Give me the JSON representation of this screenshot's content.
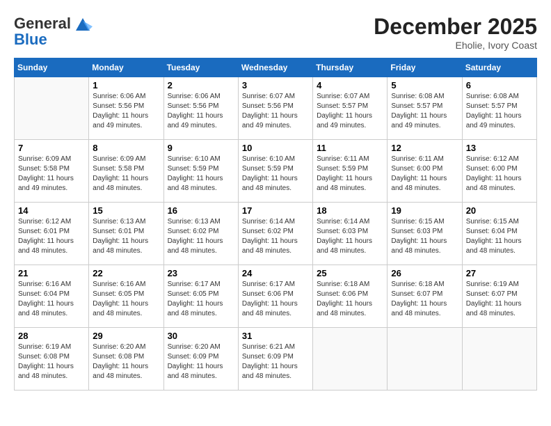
{
  "header": {
    "logo_line1": "General",
    "logo_line2": "Blue",
    "month": "December 2025",
    "location": "Eholie, Ivory Coast"
  },
  "weekdays": [
    "Sunday",
    "Monday",
    "Tuesday",
    "Wednesday",
    "Thursday",
    "Friday",
    "Saturday"
  ],
  "weeks": [
    [
      {
        "day": "",
        "sunrise": "",
        "sunset": "",
        "daylight": ""
      },
      {
        "day": "1",
        "sunrise": "Sunrise: 6:06 AM",
        "sunset": "Sunset: 5:56 PM",
        "daylight": "Daylight: 11 hours and 49 minutes."
      },
      {
        "day": "2",
        "sunrise": "Sunrise: 6:06 AM",
        "sunset": "Sunset: 5:56 PM",
        "daylight": "Daylight: 11 hours and 49 minutes."
      },
      {
        "day": "3",
        "sunrise": "Sunrise: 6:07 AM",
        "sunset": "Sunset: 5:56 PM",
        "daylight": "Daylight: 11 hours and 49 minutes."
      },
      {
        "day": "4",
        "sunrise": "Sunrise: 6:07 AM",
        "sunset": "Sunset: 5:57 PM",
        "daylight": "Daylight: 11 hours and 49 minutes."
      },
      {
        "day": "5",
        "sunrise": "Sunrise: 6:08 AM",
        "sunset": "Sunset: 5:57 PM",
        "daylight": "Daylight: 11 hours and 49 minutes."
      },
      {
        "day": "6",
        "sunrise": "Sunrise: 6:08 AM",
        "sunset": "Sunset: 5:57 PM",
        "daylight": "Daylight: 11 hours and 49 minutes."
      }
    ],
    [
      {
        "day": "7",
        "sunrise": "Sunrise: 6:09 AM",
        "sunset": "Sunset: 5:58 PM",
        "daylight": "Daylight: 11 hours and 49 minutes."
      },
      {
        "day": "8",
        "sunrise": "Sunrise: 6:09 AM",
        "sunset": "Sunset: 5:58 PM",
        "daylight": "Daylight: 11 hours and 48 minutes."
      },
      {
        "day": "9",
        "sunrise": "Sunrise: 6:10 AM",
        "sunset": "Sunset: 5:59 PM",
        "daylight": "Daylight: 11 hours and 48 minutes."
      },
      {
        "day": "10",
        "sunrise": "Sunrise: 6:10 AM",
        "sunset": "Sunset: 5:59 PM",
        "daylight": "Daylight: 11 hours and 48 minutes."
      },
      {
        "day": "11",
        "sunrise": "Sunrise: 6:11 AM",
        "sunset": "Sunset: 5:59 PM",
        "daylight": "Daylight: 11 hours and 48 minutes."
      },
      {
        "day": "12",
        "sunrise": "Sunrise: 6:11 AM",
        "sunset": "Sunset: 6:00 PM",
        "daylight": "Daylight: 11 hours and 48 minutes."
      },
      {
        "day": "13",
        "sunrise": "Sunrise: 6:12 AM",
        "sunset": "Sunset: 6:00 PM",
        "daylight": "Daylight: 11 hours and 48 minutes."
      }
    ],
    [
      {
        "day": "14",
        "sunrise": "Sunrise: 6:12 AM",
        "sunset": "Sunset: 6:01 PM",
        "daylight": "Daylight: 11 hours and 48 minutes."
      },
      {
        "day": "15",
        "sunrise": "Sunrise: 6:13 AM",
        "sunset": "Sunset: 6:01 PM",
        "daylight": "Daylight: 11 hours and 48 minutes."
      },
      {
        "day": "16",
        "sunrise": "Sunrise: 6:13 AM",
        "sunset": "Sunset: 6:02 PM",
        "daylight": "Daylight: 11 hours and 48 minutes."
      },
      {
        "day": "17",
        "sunrise": "Sunrise: 6:14 AM",
        "sunset": "Sunset: 6:02 PM",
        "daylight": "Daylight: 11 hours and 48 minutes."
      },
      {
        "day": "18",
        "sunrise": "Sunrise: 6:14 AM",
        "sunset": "Sunset: 6:03 PM",
        "daylight": "Daylight: 11 hours and 48 minutes."
      },
      {
        "day": "19",
        "sunrise": "Sunrise: 6:15 AM",
        "sunset": "Sunset: 6:03 PM",
        "daylight": "Daylight: 11 hours and 48 minutes."
      },
      {
        "day": "20",
        "sunrise": "Sunrise: 6:15 AM",
        "sunset": "Sunset: 6:04 PM",
        "daylight": "Daylight: 11 hours and 48 minutes."
      }
    ],
    [
      {
        "day": "21",
        "sunrise": "Sunrise: 6:16 AM",
        "sunset": "Sunset: 6:04 PM",
        "daylight": "Daylight: 11 hours and 48 minutes."
      },
      {
        "day": "22",
        "sunrise": "Sunrise: 6:16 AM",
        "sunset": "Sunset: 6:05 PM",
        "daylight": "Daylight: 11 hours and 48 minutes."
      },
      {
        "day": "23",
        "sunrise": "Sunrise: 6:17 AM",
        "sunset": "Sunset: 6:05 PM",
        "daylight": "Daylight: 11 hours and 48 minutes."
      },
      {
        "day": "24",
        "sunrise": "Sunrise: 6:17 AM",
        "sunset": "Sunset: 6:06 PM",
        "daylight": "Daylight: 11 hours and 48 minutes."
      },
      {
        "day": "25",
        "sunrise": "Sunrise: 6:18 AM",
        "sunset": "Sunset: 6:06 PM",
        "daylight": "Daylight: 11 hours and 48 minutes."
      },
      {
        "day": "26",
        "sunrise": "Sunrise: 6:18 AM",
        "sunset": "Sunset: 6:07 PM",
        "daylight": "Daylight: 11 hours and 48 minutes."
      },
      {
        "day": "27",
        "sunrise": "Sunrise: 6:19 AM",
        "sunset": "Sunset: 6:07 PM",
        "daylight": "Daylight: 11 hours and 48 minutes."
      }
    ],
    [
      {
        "day": "28",
        "sunrise": "Sunrise: 6:19 AM",
        "sunset": "Sunset: 6:08 PM",
        "daylight": "Daylight: 11 hours and 48 minutes."
      },
      {
        "day": "29",
        "sunrise": "Sunrise: 6:20 AM",
        "sunset": "Sunset: 6:08 PM",
        "daylight": "Daylight: 11 hours and 48 minutes."
      },
      {
        "day": "30",
        "sunrise": "Sunrise: 6:20 AM",
        "sunset": "Sunset: 6:09 PM",
        "daylight": "Daylight: 11 hours and 48 minutes."
      },
      {
        "day": "31",
        "sunrise": "Sunrise: 6:21 AM",
        "sunset": "Sunset: 6:09 PM",
        "daylight": "Daylight: 11 hours and 48 minutes."
      },
      {
        "day": "",
        "sunrise": "",
        "sunset": "",
        "daylight": ""
      },
      {
        "day": "",
        "sunrise": "",
        "sunset": "",
        "daylight": ""
      },
      {
        "day": "",
        "sunrise": "",
        "sunset": "",
        "daylight": ""
      }
    ]
  ]
}
